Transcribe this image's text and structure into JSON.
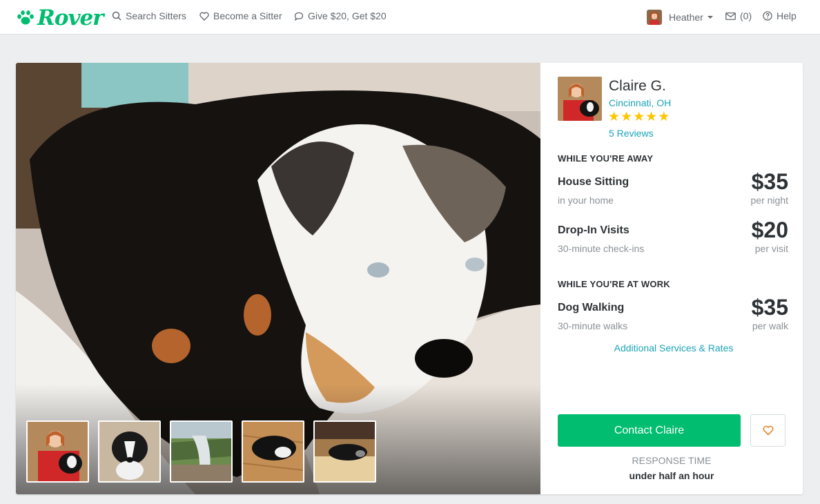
{
  "brand": {
    "name": "Rover",
    "color": "#00bd70",
    "icon": "paw-icon"
  },
  "nav": {
    "search_sitters": "Search Sitters",
    "become_sitter": "Become a Sitter",
    "referral": "Give $20, Get $20",
    "user_name": "Heather",
    "messages": "(0)",
    "help": "Help"
  },
  "sitter": {
    "name": "Claire G.",
    "location": "Cincinnati, OH",
    "rating_stars": 5,
    "reviews": "5 Reviews"
  },
  "sections": {
    "away": "WHILE YOU'RE AWAY",
    "work": "WHILE YOU'RE AT WORK"
  },
  "services": [
    {
      "name": "House Sitting",
      "desc": "in your home",
      "price": "$35",
      "per": "per night"
    },
    {
      "name": "Drop-In Visits",
      "desc": "30-minute check-ins",
      "price": "$20",
      "per": "per visit"
    },
    {
      "name": "Dog Walking",
      "desc": "30-minute walks",
      "price": "$35",
      "per": "per walk"
    }
  ],
  "additional_link": "Additional Services & Rates",
  "contact_button": "Contact Claire",
  "favorite_icon": "heart-icon",
  "response": {
    "label": "RESPONSE TIME",
    "value": "under half an hour"
  },
  "colors": {
    "accent": "#00bd70",
    "link": "#1da4b7",
    "star": "#fcc500",
    "heart": "#e0862a"
  }
}
